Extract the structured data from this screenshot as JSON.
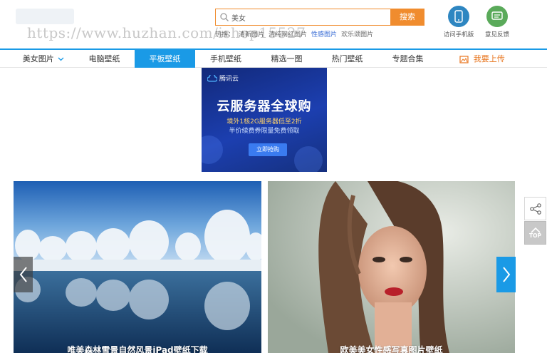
{
  "watermark": "https://www.huzhan.com/ishop15527",
  "search": {
    "value": "美女",
    "button_label": "搜索",
    "hot_label": "热搜：",
    "hot_links": [
      "清新图片",
      "清纯网红图片",
      "性感图片",
      "欢乐颂图片"
    ]
  },
  "header_actions": {
    "mobile_label": "访问手机版",
    "feedback_label": "意见反馈",
    "mobile_color": "#2e86c1",
    "feedback_color": "#5aaa5a"
  },
  "nav": {
    "items": [
      {
        "label": "美女图片",
        "dropdown": true
      },
      {
        "label": "电脑壁纸"
      },
      {
        "label": "平板壁纸",
        "active": true
      },
      {
        "label": "手机壁纸"
      },
      {
        "label": "精选一图"
      },
      {
        "label": "热门壁纸"
      },
      {
        "label": "专题合集"
      }
    ],
    "upload_label": "我要上传",
    "accent_color": "#1a9ae6"
  },
  "ad": {
    "brand": "腾讯云",
    "title": "云服务器全球购",
    "subtitle1": "境外1核2G服务器低至2折",
    "subtitle2": "半价续费券限量免费领取",
    "button_label": "立即抢购"
  },
  "carousel": {
    "slides": [
      {
        "caption": "唯美森林雪景自然风景iPad壁纸下载",
        "image": "snowy-trees-lake"
      },
      {
        "caption": "欧美美女性感写真图片壁纸",
        "image": "wet-hair-woman-portrait"
      }
    ]
  },
  "side_tools": {
    "share_icon": "share-icon",
    "top_label": "TOP"
  }
}
